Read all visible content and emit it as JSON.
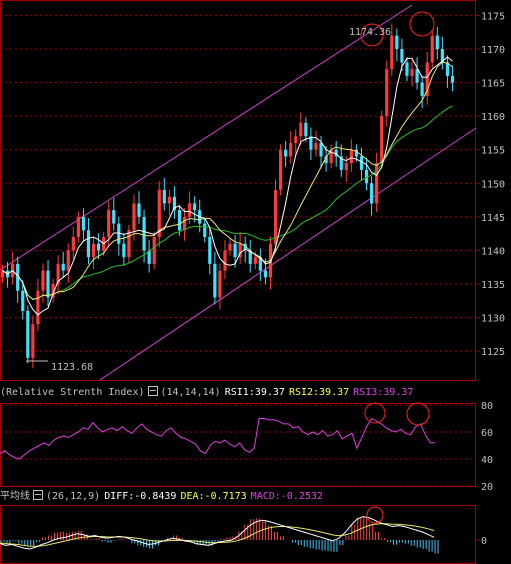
{
  "colors": {
    "background": "#000000",
    "frame": "#a00000",
    "axis_text": "#c0c0c0",
    "candle_up": "#ff3a3a",
    "candle_down": "#40e0ff",
    "ma_short": "#ffffff",
    "ma_mid": "#e8e87a",
    "ma_long": "#22c022",
    "channel": "#d040d0",
    "rsi_line": "#e040e0",
    "highlight_circle": "#ff2020",
    "dif_line": "#ffffff",
    "dea_line": "#e8e860",
    "macd_hist_pos": "#ff4040",
    "macd_hist_neg": "#40c8ff"
  },
  "price_panel": {
    "y_ticks": [
      "1175",
      "1170",
      "1165",
      "1160",
      "1155",
      "1150",
      "1145",
      "1140",
      "1135",
      "1130",
      "1125"
    ],
    "annotation_high": "1174.36",
    "annotation_low": "1123.68"
  },
  "rsi_panel": {
    "title": "(Relative Strenth Index)",
    "params": "(14,14,14)",
    "rsi1": "RSI1:39.37",
    "rsi2": "RSI2:39.37",
    "rsi3": "RSI3:39.37",
    "y_ticks": [
      "80",
      "60",
      "40",
      "20"
    ]
  },
  "macd_panel": {
    "title": "平均线",
    "params": "(26,12,9)",
    "diff": "DIFF:-0.8439",
    "dea": "DEA:-0.7173",
    "macd": "MACD:-0.2532",
    "y_ticks": [
      "0"
    ]
  },
  "chart_data": {
    "type": "candlestick",
    "ylim": [
      1121,
      1177
    ],
    "high_label": "1174.36",
    "low_label": "1123.68",
    "ohlc_close_trace": [
      1137,
      1136,
      1138,
      1134,
      1131,
      1124,
      1129,
      1134,
      1137,
      1133,
      1135,
      1138,
      1137,
      1140,
      1142,
      1145,
      1143,
      1139,
      1141,
      1140,
      1142,
      1146,
      1144,
      1141,
      1139,
      1143,
      1147,
      1145,
      1140,
      1138,
      1142,
      1149,
      1147,
      1148,
      1146,
      1143,
      1145,
      1147,
      1146,
      1144,
      1142,
      1138,
      1133,
      1137,
      1140,
      1141,
      1139,
      1141,
      1140,
      1138,
      1139,
      1137,
      1136,
      1141,
      1149,
      1155,
      1154,
      1156,
      1157,
      1159,
      1157,
      1155,
      1156,
      1154,
      1153,
      1155,
      1154,
      1152,
      1153,
      1155,
      1154,
      1152,
      1150,
      1147,
      1153,
      1160,
      1167,
      1172,
      1170,
      1168,
      1166,
      1167,
      1165,
      1163,
      1168,
      1172,
      1170,
      1168,
      1166,
      1165
    ],
    "rsi": {
      "ylim": [
        20,
        80
      ],
      "values": [
        44,
        46,
        43,
        41,
        40,
        43,
        46,
        48,
        50,
        52,
        50,
        54,
        56,
        57,
        56,
        58,
        60,
        63,
        62,
        67,
        63,
        60,
        62,
        63,
        61,
        64,
        61,
        59,
        63,
        66,
        62,
        60,
        58,
        57,
        61,
        63,
        59,
        56,
        55,
        53,
        51,
        46,
        44,
        50,
        53,
        52,
        54,
        51,
        49,
        52,
        47,
        45,
        48,
        70,
        70,
        69,
        69,
        68,
        66,
        66,
        63,
        64,
        60,
        58,
        60,
        58,
        61,
        57,
        58,
        61,
        55,
        57,
        59,
        48,
        56,
        64,
        70,
        68,
        66,
        63,
        61,
        60,
        62,
        59,
        58,
        64,
        66,
        58,
        52,
        52
      ],
      "yticks": [
        80,
        60,
        40,
        20
      ]
    },
    "macd": {
      "dif": [
        -0.4,
        -0.6,
        -0.5,
        -0.7,
        -0.9,
        -1.0,
        -0.8,
        -0.5,
        -0.3,
        0.0,
        0.2,
        0.3,
        0.5,
        0.7,
        0.6,
        0.4,
        0.5,
        0.3,
        0.2,
        0.3,
        0.4,
        0.3,
        0.1,
        -0.1,
        -0.3,
        -0.5,
        -0.4,
        -0.2,
        0.0,
        0.2,
        0.1,
        -0.1,
        -0.2,
        -0.4,
        -0.5,
        -0.6,
        -0.4,
        -0.2,
        -0.1,
        0.0,
        0.4,
        1.0,
        1.6,
        2.0,
        2.2,
        2.1,
        1.9,
        1.7,
        1.5,
        1.3,
        1.1,
        0.9,
        0.7,
        0.5,
        0.3,
        0.1,
        -0.1,
        0.2,
        0.8,
        1.6,
        2.3,
        2.6,
        2.5,
        2.2,
        1.9,
        1.7,
        1.5,
        1.6,
        1.5,
        1.3,
        1.1,
        0.9,
        0.6,
        0.3
      ],
      "dea": [
        -0.3,
        -0.4,
        -0.45,
        -0.5,
        -0.6,
        -0.7,
        -0.7,
        -0.65,
        -0.55,
        -0.4,
        -0.25,
        -0.1,
        0.05,
        0.2,
        0.3,
        0.35,
        0.4,
        0.38,
        0.35,
        0.33,
        0.33,
        0.32,
        0.28,
        0.2,
        0.1,
        -0.02,
        -0.1,
        -0.12,
        -0.1,
        -0.05,
        -0.02,
        -0.04,
        -0.07,
        -0.13,
        -0.2,
        -0.28,
        -0.3,
        -0.28,
        -0.25,
        -0.2,
        -0.08,
        0.15,
        0.45,
        0.8,
        1.1,
        1.3,
        1.45,
        1.5,
        1.5,
        1.45,
        1.38,
        1.28,
        1.16,
        1.02,
        0.88,
        0.72,
        0.56,
        0.48,
        0.55,
        0.75,
        1.05,
        1.35,
        1.6,
        1.75,
        1.8,
        1.8,
        1.76,
        1.74,
        1.7,
        1.62,
        1.52,
        1.4,
        1.24,
        1.05
      ],
      "yticks": [
        0
      ]
    }
  }
}
